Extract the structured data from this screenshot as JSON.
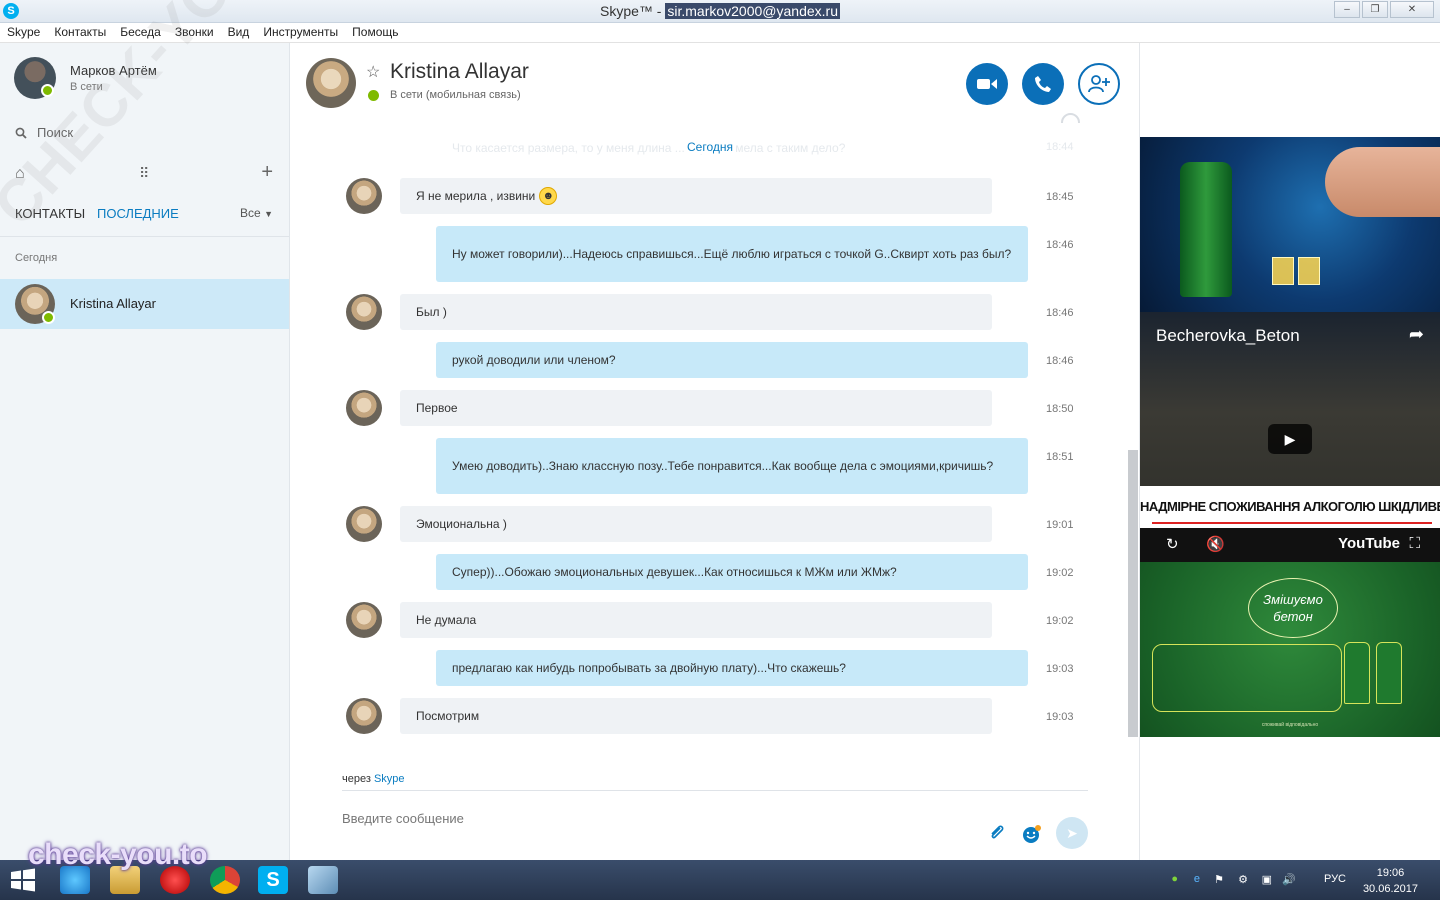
{
  "window": {
    "title_app": "Skype™ - ",
    "title_account": "sir.markov2000@yandex.ru",
    "btn_min": "‒",
    "btn_max": "❐",
    "btn_close": "✕"
  },
  "menu": [
    "Skype",
    "Контакты",
    "Беседа",
    "Звонки",
    "Вид",
    "Инструменты",
    "Помощь"
  ],
  "profile": {
    "name": "Марков Артём",
    "status": "В сети"
  },
  "search": {
    "label": "Поиск"
  },
  "tabs": {
    "contacts": "КОНТАКТЫ",
    "recent": "ПОСЛЕДНИЕ",
    "filter": "Все"
  },
  "recent": {
    "section": "Сегодня",
    "contact": "Kristina Allayar"
  },
  "chat": {
    "name": "Kristina Allayar",
    "status": "В сети (мобильная связь)",
    "date_divider": "Сегодня",
    "faded_message": "Что касается размера, то у меня длина ... етр 5...Имела с таким дело?",
    "faded_time": "18:44",
    "messages": [
      {
        "dir": "in",
        "text": "Я не мерила , извини",
        "time": "18:45",
        "emoji": true
      },
      {
        "dir": "out",
        "text": "Ну может говорили)...Надеюсь справишься...Ещё люблю играться с точкой G..Сквирт хоть раз был?",
        "time": "18:46"
      },
      {
        "dir": "in",
        "text": "Был )",
        "time": "18:46"
      },
      {
        "dir": "out",
        "text": "рукой доводили или членом?",
        "time": "18:46"
      },
      {
        "dir": "in",
        "text": "Первое",
        "time": "18:50"
      },
      {
        "dir": "out",
        "text": "Умею доводить)..Знаю классную позу..Тебе понравится...Как вообще дела с эмоциями,кричишь?",
        "time": "18:51"
      },
      {
        "dir": "in",
        "text": "Эмоциональна )",
        "time": "19:01"
      },
      {
        "dir": "out",
        "text": "Супер))...Обожаю эмоциональных девушек...Как относишься к МЖм или ЖМж?",
        "time": "19:02"
      },
      {
        "dir": "in",
        "text": "Не думала",
        "time": "19:02"
      },
      {
        "dir": "out",
        "text": "предлагаю как нибудь попробывать за двойную плату)...Что скажешь?",
        "time": "19:03"
      },
      {
        "dir": "in",
        "text": "Посмотрим",
        "time": "19:03"
      }
    ],
    "via_prefix": "через",
    "via_link": "Skype",
    "composer_placeholder": "Введите сообщение"
  },
  "ads": {
    "video_title": "Becherovka_Beton",
    "video_warning": "НАДМІРНЕ СПОЖИВАННЯ АЛКОГОЛЮ ШКІДЛИВЕ ДЛЯ ВАШОГО ЗДОРОВ'Я",
    "youtube_label": "YouTube",
    "bottom_slogan": "Змішуємо бетон",
    "bottom_fine": "споживай відповідально"
  },
  "taskbar": {
    "lang": "РУС",
    "time": "19:06",
    "date": "30.06.2017"
  },
  "watermark": {
    "main": "check-you.to",
    "diagonal": "CHECK-YOU.ME"
  },
  "colors": {
    "accent": "#0b6fb8",
    "link": "#0a7cc1",
    "online": "#7fba00",
    "incoming_bubble": "#eff2f5",
    "outgoing_bubble": "#c7e9f9",
    "selected_row": "#cde9f8"
  }
}
